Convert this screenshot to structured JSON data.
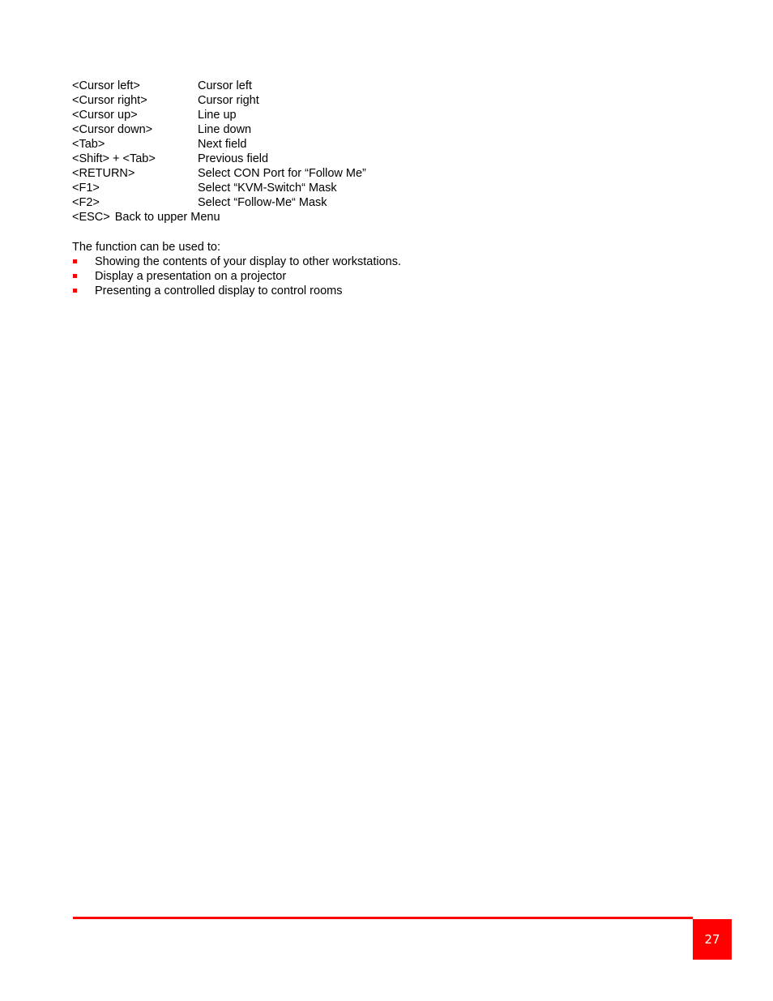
{
  "document": {
    "key_bindings": [
      {
        "key": "<Cursor left>",
        "action": "Cursor left"
      },
      {
        "key": "<Cursor right>",
        "action": "Cursor right"
      },
      {
        "key": "<Cursor up>",
        "action": "Line up"
      },
      {
        "key": "<Cursor down>",
        "action": "Line down"
      },
      {
        "key": "<Tab>",
        "action": "Next field"
      },
      {
        "key": "<Shift> + <Tab>",
        "action": "Previous field"
      },
      {
        "key": "<RETURN>",
        "action": "Select CON Port for “Follow Me”"
      },
      {
        "key": "<F1>",
        "action": "Select “KVM-Switch“ Mask"
      },
      {
        "key": "<F2>",
        "action": "Select “Follow-Me“ Mask"
      },
      {
        "key": "<ESC>",
        "action": "Back to upper Menu"
      }
    ],
    "intro_text": "The function can be used to:",
    "bullets": [
      "Showing the contents of your display to other workstations.",
      "Display a presentation on a projector",
      "Presenting a controlled display to control rooms"
    ]
  },
  "footer": {
    "page_number": "27",
    "accent_color": "#ff0000",
    "page_number_color": "#ffffff"
  }
}
